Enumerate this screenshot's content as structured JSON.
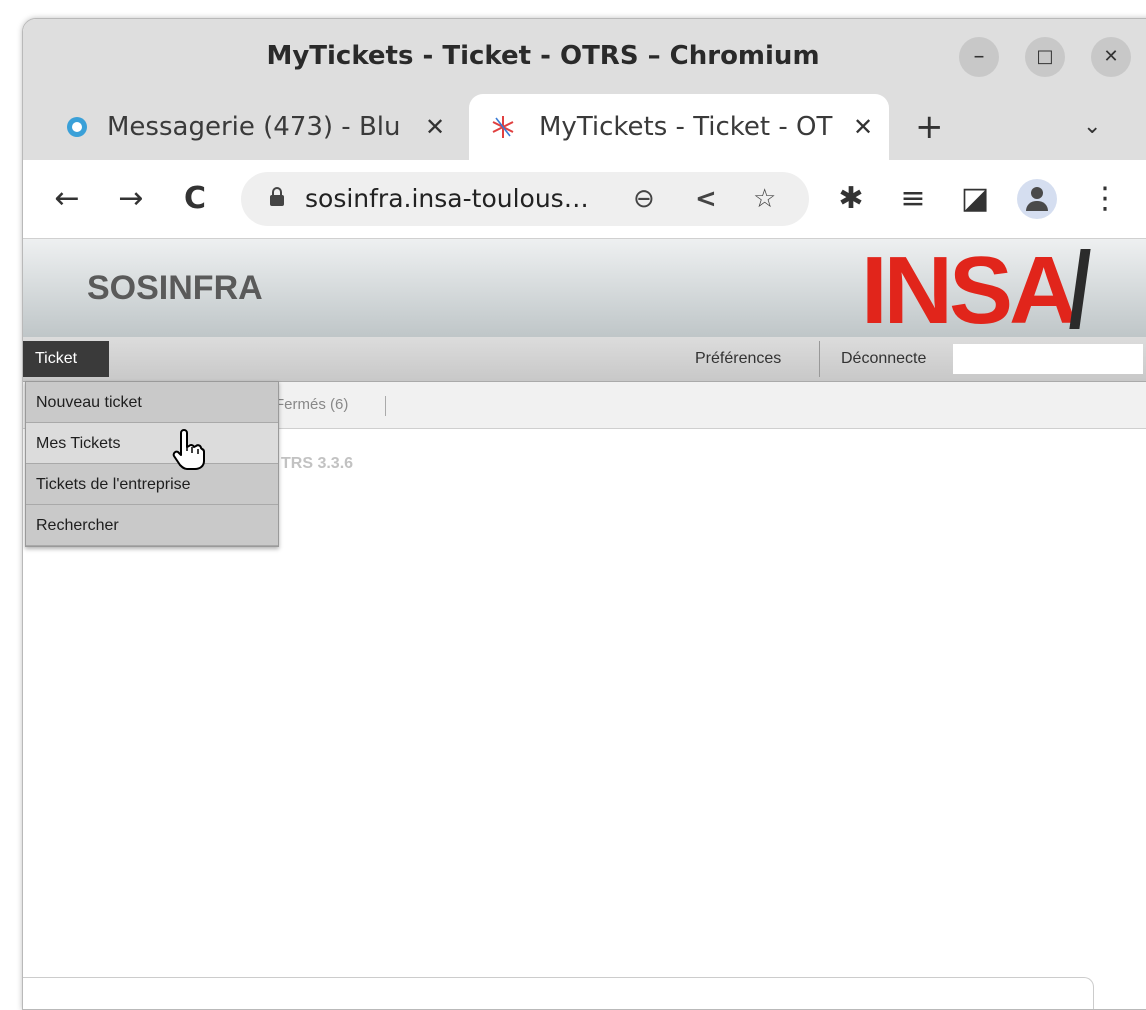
{
  "window": {
    "title": "MyTickets - Ticket - OTRS – Chromium",
    "controls": {
      "minimize": "–",
      "maximize": "□",
      "close": "✕"
    }
  },
  "tabs": [
    {
      "label": "Messagerie (473) - Blu",
      "close": "✕",
      "icon": "bluemind-icon",
      "active": false
    },
    {
      "label": "MyTickets - Ticket - OT",
      "close": "✕",
      "icon": "otrs-icon",
      "active": true
    }
  ],
  "tabstrip": {
    "new_tab": "+",
    "tab_menu": "⌄"
  },
  "toolbar": {
    "back": "←",
    "forward": "→",
    "reload": "C",
    "url": "sosinfra.insa-toulous…",
    "zoom": "⊖",
    "share": "<",
    "bookmark": "☆",
    "extensions": "✱",
    "media": "≡",
    "sidepanel": "◪",
    "menu": "⋮"
  },
  "header": {
    "brand": "SOSINFRA",
    "logo": "INSA"
  },
  "nav": {
    "ticket": "Ticket",
    "preferences": "Préférences",
    "logout": "Déconnecte"
  },
  "subnav": {
    "closed": "Fermés (6)"
  },
  "content": {
    "version": "TRS 3.3.6"
  },
  "dropdown": {
    "items": [
      {
        "label": "Nouveau ticket"
      },
      {
        "label": "Mes Tickets"
      },
      {
        "label": "Tickets de l'entreprise"
      },
      {
        "label": "Rechercher"
      }
    ]
  },
  "colors": {
    "logo": "#e1251b",
    "nav_active": "#3a3a3a"
  }
}
